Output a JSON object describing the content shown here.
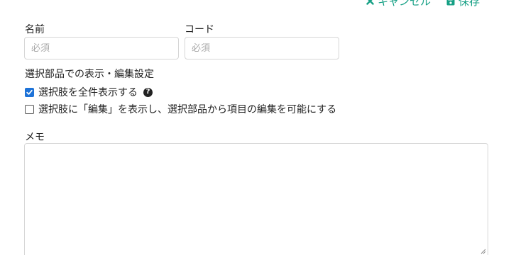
{
  "header": {
    "cancel_label": "キャンセル",
    "save_label": "保存",
    "accent_color": "#16a085"
  },
  "form": {
    "name": {
      "label": "名前",
      "value": "",
      "placeholder": "必須"
    },
    "code": {
      "label": "コード",
      "value": "",
      "placeholder": "必須"
    },
    "display_section": {
      "title": "選択部品での表示・編集設定",
      "options": [
        {
          "label": "選択肢を全件表示する",
          "checked": true,
          "help_icon": "question-circle-icon"
        },
        {
          "label": "選択肢に「編集」を表示し、選択部品から項目の編集を可能にする",
          "checked": false
        }
      ]
    },
    "memo": {
      "label": "メモ",
      "value": ""
    }
  },
  "colors": {
    "checkbox_checked": "#1e73d8",
    "input_border": "#d6d6d6"
  }
}
